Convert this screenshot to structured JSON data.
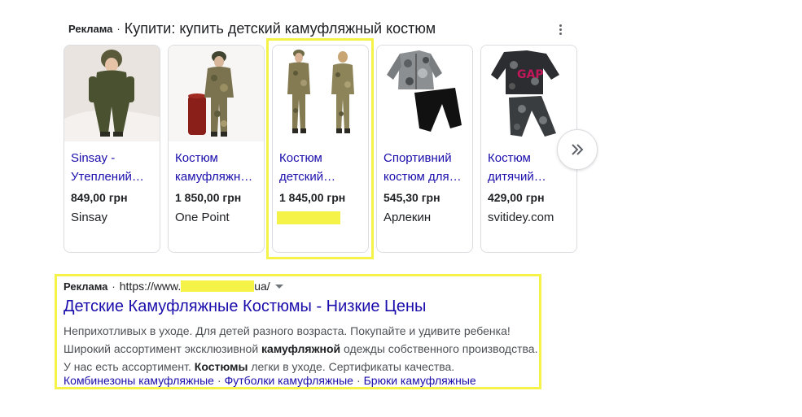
{
  "shopping": {
    "ad_label": "Реклама",
    "separator": "·",
    "title": "Купити: купить детский камуфляжный костюм",
    "more_icon": "more-vert-icon",
    "next_icon": "double-chevron-right-icon",
    "products": [
      {
        "title": "Sinsay - Утеплений…",
        "price": "849,00 грн",
        "seller": "Sinsay",
        "image": "child-green-snowsuit"
      },
      {
        "title": "Костюм камуфляжн…",
        "price": "1 850,00 грн",
        "seller": "One Point",
        "image": "child-camo-suit-barrel"
      },
      {
        "title": "Костюм детский…",
        "price": "1 845,00 грн",
        "seller": "",
        "image": "two-kids-camo-suits"
      },
      {
        "title": "Спортивний костюм для…",
        "price": "545,30 грн",
        "seller": "Арлекин",
        "image": "grey-camo-tracksuit"
      },
      {
        "title": "Костюм дитячий…",
        "price": "429,00 грн",
        "seller": "svitidey.com",
        "image": "camo-gap-sweatsuit"
      }
    ]
  },
  "text_ad": {
    "ad_label": "Реклама",
    "separator": "·",
    "url_prefix": "https://www.",
    "url_suffix": "ua/",
    "title": "Детские Камуфляжные Костюмы - Низкие Цены",
    "desc_1": "Неприхотливых в уходе. Для детей разного возраста. Покупайте и удивите ребенка! Широкий ассортимент эксклюзивной ",
    "desc_bold_1": "камуфляжной",
    "desc_2": " одежды собственного производства. У нас есть ассортимент. ",
    "desc_bold_2": "Костюмы",
    "desc_3": " легки в уходе. Сертификаты качества.",
    "sitelinks": [
      "Комбинезоны камуфляжные",
      "Футболки камуфляжные",
      "Брюки камуфляжные"
    ],
    "sitelink_separator": "·"
  },
  "colors": {
    "highlight": "#f6f348",
    "link": "#1a0dab"
  }
}
